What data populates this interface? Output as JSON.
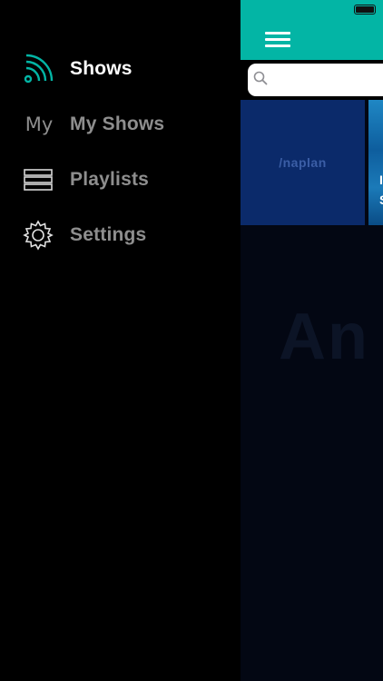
{
  "sidebar": {
    "items": [
      {
        "label": "Shows",
        "icon": "rss-feed-icon",
        "active": true
      },
      {
        "label": "My Shows",
        "icon": "my-icon",
        "icon_text": "My",
        "active": false
      },
      {
        "label": "Playlists",
        "icon": "list-icon",
        "active": false
      },
      {
        "label": "Settings",
        "icon": "gear-icon",
        "active": false
      }
    ]
  },
  "colors": {
    "accent": "#03b5a5",
    "sidebar_bg": "#000000",
    "content_bg": "#030713",
    "active_text": "#ffffff",
    "inactive_text": "#8e8e8e"
  },
  "search": {
    "placeholder": "",
    "value": ""
  },
  "tiles": [
    {
      "brand": "naplan",
      "logo_mark": "/"
    },
    {
      "text_lines": [
        "I",
        "S"
      ]
    }
  ],
  "watermark": {
    "text": "An"
  }
}
